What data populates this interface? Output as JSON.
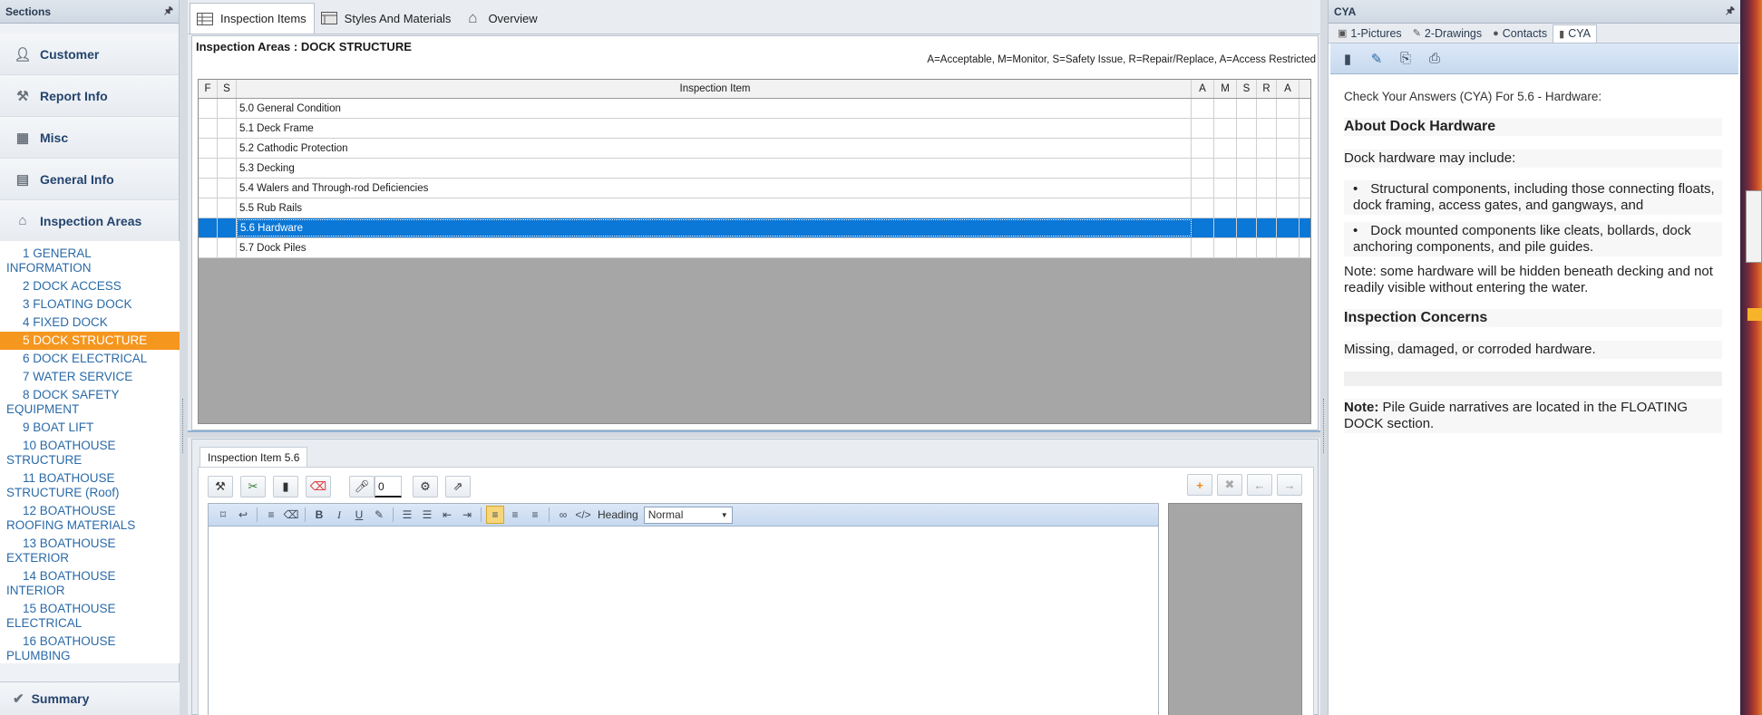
{
  "sidebar": {
    "title": "Sections",
    "nav": [
      {
        "label": "Customer",
        "icon": "person-icon"
      },
      {
        "label": "Report Info",
        "icon": "wrench-icon"
      },
      {
        "label": "Misc",
        "icon": "calculator-icon"
      },
      {
        "label": "General Info",
        "icon": "document-icon"
      },
      {
        "label": "Inspection Areas",
        "icon": "home-icon"
      }
    ],
    "areas": [
      {
        "num": "1",
        "label": "GENERAL INFORMATION"
      },
      {
        "num": "2",
        "label": "DOCK ACCESS"
      },
      {
        "num": "3",
        "label": "FLOATING DOCK"
      },
      {
        "num": "4",
        "label": "FIXED DOCK"
      },
      {
        "num": "5",
        "label": "DOCK STRUCTURE"
      },
      {
        "num": "6",
        "label": "DOCK ELECTRICAL"
      },
      {
        "num": "7",
        "label": "WATER SERVICE"
      },
      {
        "num": "8",
        "label": "DOCK SAFETY EQUIPMENT"
      },
      {
        "num": "9",
        "label": "BOAT LIFT"
      },
      {
        "num": "10",
        "label": "BOATHOUSE STRUCTURE"
      },
      {
        "num": "11",
        "label": "BOATHOUSE STRUCTURE (Roof)"
      },
      {
        "num": "12",
        "label": "BOATHOUSE ROOFING MATERIALS"
      },
      {
        "num": "13",
        "label": "BOATHOUSE EXTERIOR"
      },
      {
        "num": "14",
        "label": "BOATHOUSE INTERIOR"
      },
      {
        "num": "15",
        "label": "BOATHOUSE ELECTRICAL"
      },
      {
        "num": "16",
        "label": "BOATHOUSE PLUMBING"
      }
    ],
    "active_area": "5",
    "summary": "Summary"
  },
  "center": {
    "tabs": [
      {
        "label": "Inspection Items",
        "icon": "grid-icon"
      },
      {
        "label": "Styles And Materials",
        "icon": "table-icon"
      },
      {
        "label": "Overview",
        "icon": "house-icon"
      }
    ],
    "title": "Inspection Areas : DOCK STRUCTURE",
    "legend": "A=Acceptable, M=Monitor, S=Safety Issue, R=Repair/Replace, A=Access Restricted",
    "grid_headers": [
      "F",
      "S",
      "Inspection Item",
      "A",
      "M",
      "S",
      "R",
      "A"
    ],
    "items": [
      "5.0 General Condition",
      "5.1 Deck Frame",
      "5.2 Cathodic Protection",
      "5.3 Decking",
      "5.4 Walers and Through-rod Deficiencies",
      "5.5 Rub Rails",
      "5.6 Hardware",
      "5.7 Dock Piles"
    ],
    "selected_index": 6
  },
  "editor": {
    "tab": "Inspection Item 5.6",
    "counter": "0",
    "heading_label": "Heading",
    "heading_value": "Normal"
  },
  "cya": {
    "title": "CYA",
    "tabs": [
      {
        "label": "1-Pictures",
        "icon": "camera-icon"
      },
      {
        "label": "2-Drawings",
        "icon": "pencil-icon"
      },
      {
        "label": "Contacts",
        "icon": "contact-icon"
      },
      {
        "label": "CYA",
        "icon": "book-icon"
      }
    ],
    "intro": "Check Your Answers (CYA) For 5.6 - Hardware:",
    "h1": "About Dock Hardware",
    "p1": "Dock hardware may include:",
    "li1": "Structural components, including those connecting floats, dock framing, access gates, and gangways,  and",
    "li2": "Dock mounted components like cleats, bollards, dock anchoring components, and pile guides.",
    "p2": "Note: some hardware will be hidden beneath decking and not readily visible without entering the water.",
    "h2": "Inspection Concerns",
    "p3": "Missing, damaged, or corroded hardware.",
    "note_bold": "Note:",
    "note_text": " Pile Guide narratives are located in the FLOATING DOCK section."
  },
  "colors": {
    "accent": "#0b77d6",
    "active_area": "#f5961e",
    "link": "#2a6aa8"
  }
}
